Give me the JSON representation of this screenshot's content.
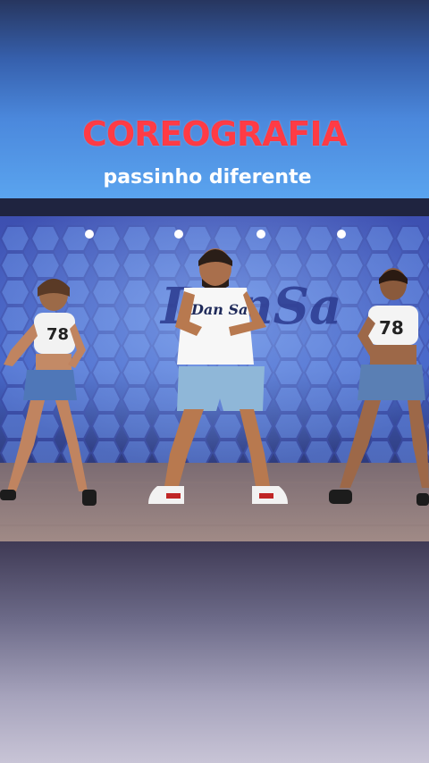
{
  "overlay": {
    "title": "COREOGRAFIA",
    "subtitle": "passinho diferente"
  },
  "video": {
    "studio_logo_text": "DanSa",
    "shirt_text_center": "Dan Sa",
    "shirt_number_left": "78",
    "shirt_number_right": "78"
  },
  "colors": {
    "title_red": "#ff3b45",
    "subtitle_white": "#ffffff",
    "top_blue": "#4b88dc"
  }
}
